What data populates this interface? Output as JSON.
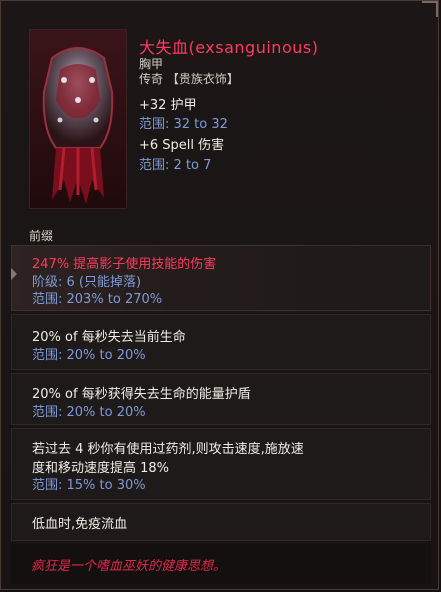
{
  "item": {
    "name": "大失血(exsanguinous)",
    "slot": "胸甲",
    "rarity": "传奇 【贵族衣饰】",
    "stats": [
      {
        "text": "+32 护甲",
        "range": "范围: 32 to 32"
      },
      {
        "text": "+6 Spell 伤害",
        "range": "范围: 2 to 7"
      }
    ]
  },
  "section": {
    "prefix_label": "前缀"
  },
  "affixes": [
    {
      "line1": "247% 提高影子使用技能的伤害",
      "line2": "阶级: 6 (只能掉落)",
      "line3": "范围: 203% to 270%"
    },
    {
      "line1": "20% of 每秒失去当前生命",
      "line2": "范围: 20% to 20%"
    },
    {
      "line1": "20% of 每秒获得失去生命的能量护盾",
      "line2": "范围: 20% to 20%"
    },
    {
      "line1a": "若过去 4 秒你有使用过药剂,则攻击速度,施放速",
      "line1b": "度和移动速度提高 18%",
      "line2": "范围: 15% to 30%"
    },
    {
      "line1": "低血时,免疫流血"
    }
  ],
  "flavor_text": "疯狂是一个嗜血巫妖的健康思想。",
  "colors": {
    "unique_name": "#ff3a5e",
    "range": "#7e9ad8",
    "flavor": "#e0264a"
  }
}
